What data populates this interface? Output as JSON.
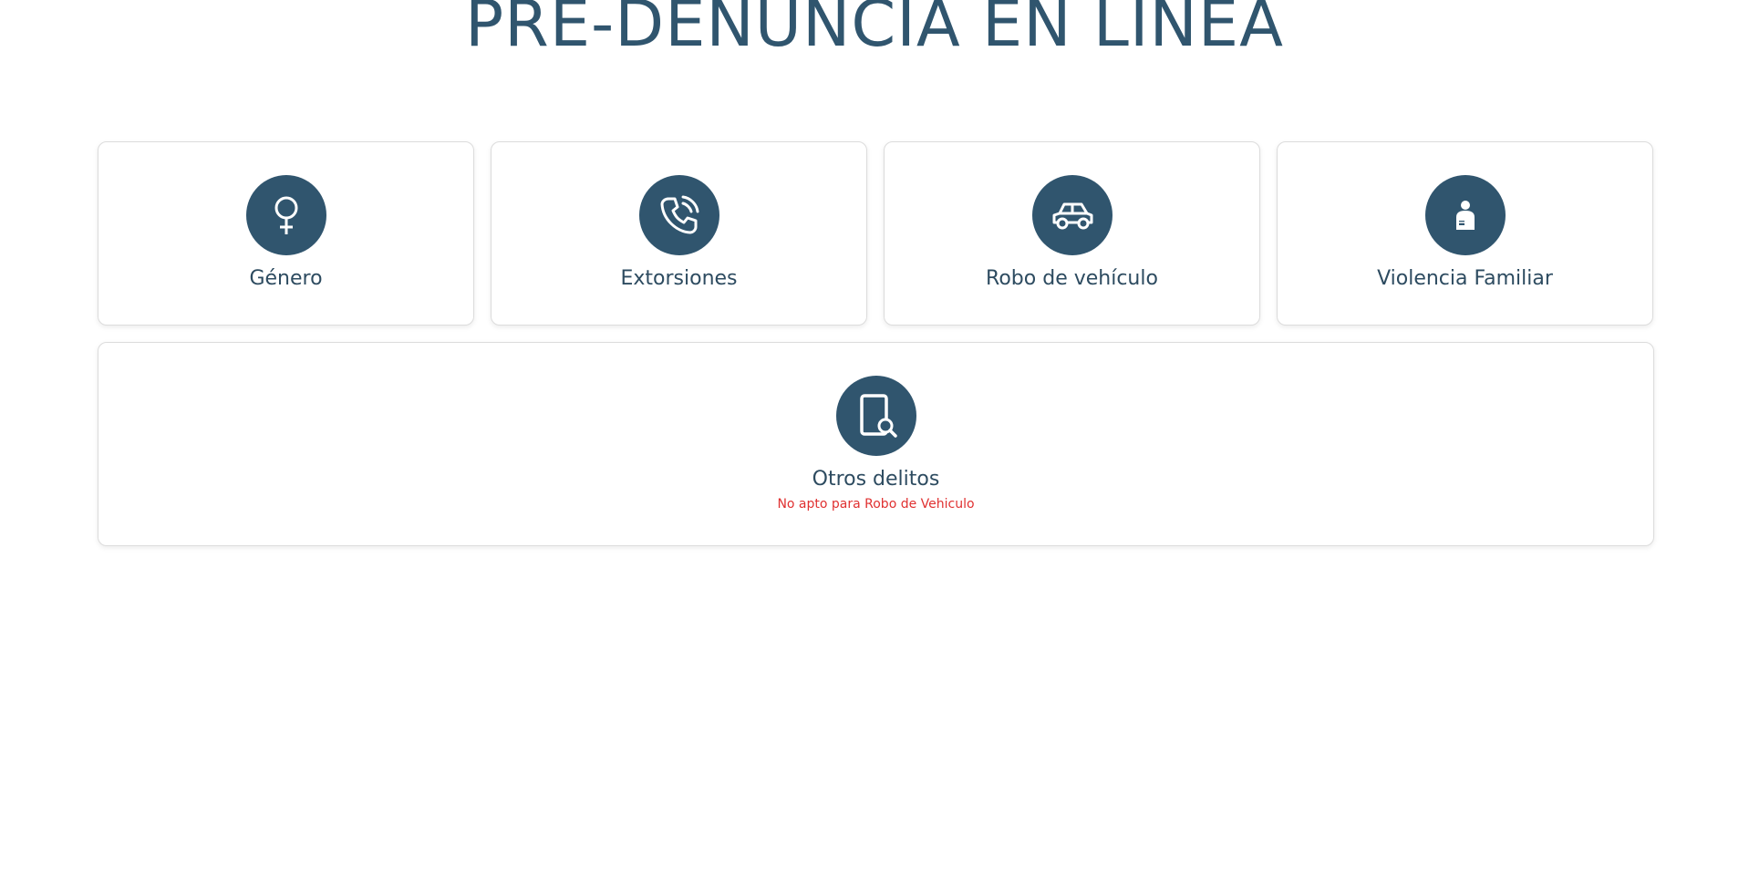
{
  "header": {
    "title": "PRE-DENUNCIA EN LÍNEA"
  },
  "cards": [
    {
      "label": "Género",
      "icon": "female-symbol-icon"
    },
    {
      "label": "Extorsiones",
      "icon": "phone-call-icon"
    },
    {
      "label": "Robo de vehículo",
      "icon": "car-icon"
    },
    {
      "label": "Violencia Familiar",
      "icon": "injured-person-icon"
    }
  ],
  "wide_card": {
    "label": "Otros delitos",
    "note": "No apto para Robo de Vehiculo",
    "icon": "document-search-icon"
  },
  "colors": {
    "accent": "#30556e",
    "text": "#2d4b60",
    "warning": "#e03131"
  }
}
